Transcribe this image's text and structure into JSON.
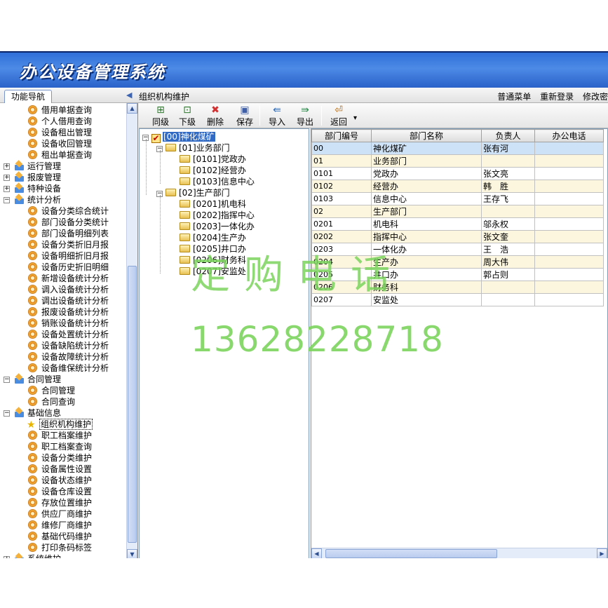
{
  "app": {
    "title": "办公设备管理系统"
  },
  "caption": {
    "nav_tab": "功能导航",
    "panel_title": "组织机构维护",
    "menu_links": [
      "普通菜单",
      "重新登录",
      "修改密"
    ]
  },
  "nav": {
    "items": [
      {
        "label": "借用单据查询",
        "kind": "leaf"
      },
      {
        "label": "个人借用查询",
        "kind": "leaf"
      },
      {
        "label": "设备租出管理",
        "kind": "leaf"
      },
      {
        "label": "设备收回管理",
        "kind": "leaf"
      },
      {
        "label": "租出单据查询",
        "kind": "leaf"
      },
      {
        "label": "运行管理",
        "kind": "group",
        "expanded": false
      },
      {
        "label": "报废管理",
        "kind": "group",
        "expanded": false
      },
      {
        "label": "特种设备",
        "kind": "group",
        "expanded": false
      },
      {
        "label": "统计分析",
        "kind": "group",
        "expanded": true
      },
      {
        "label": "设备分类综合统计",
        "kind": "leaf"
      },
      {
        "label": "部门设备分类统计",
        "kind": "leaf"
      },
      {
        "label": "部门设备明细列表",
        "kind": "leaf"
      },
      {
        "label": "设备分类折旧月报",
        "kind": "leaf"
      },
      {
        "label": "设备明细折旧月报",
        "kind": "leaf"
      },
      {
        "label": "设备历史折旧明细",
        "kind": "leaf"
      },
      {
        "label": "新增设备统计分析",
        "kind": "leaf"
      },
      {
        "label": "调入设备统计分析",
        "kind": "leaf"
      },
      {
        "label": "调出设备统计分析",
        "kind": "leaf"
      },
      {
        "label": "报废设备统计分析",
        "kind": "leaf"
      },
      {
        "label": "销账设备统计分析",
        "kind": "leaf"
      },
      {
        "label": "设备处置统计分析",
        "kind": "leaf"
      },
      {
        "label": "设备缺陷统计分析",
        "kind": "leaf"
      },
      {
        "label": "设备故障统计分析",
        "kind": "leaf"
      },
      {
        "label": "设备维保统计分析",
        "kind": "leaf"
      },
      {
        "label": "合同管理",
        "kind": "group",
        "expanded": true
      },
      {
        "label": "合同管理",
        "kind": "leaf"
      },
      {
        "label": "合同查询",
        "kind": "leaf"
      },
      {
        "label": "基础信息",
        "kind": "group",
        "expanded": true
      },
      {
        "label": "组织机构维护",
        "kind": "leaf",
        "selected": true
      },
      {
        "label": "职工档案维护",
        "kind": "leaf"
      },
      {
        "label": "职工档案查询",
        "kind": "leaf"
      },
      {
        "label": "设备分类维护",
        "kind": "leaf"
      },
      {
        "label": "设备属性设置",
        "kind": "leaf"
      },
      {
        "label": "设备状态维护",
        "kind": "leaf"
      },
      {
        "label": "设备仓库设置",
        "kind": "leaf"
      },
      {
        "label": "存放位置维护",
        "kind": "leaf"
      },
      {
        "label": "供应厂商维护",
        "kind": "leaf"
      },
      {
        "label": "维修厂商维护",
        "kind": "leaf"
      },
      {
        "label": "基础代码维护",
        "kind": "leaf"
      },
      {
        "label": "打印条码标签",
        "kind": "leaf"
      },
      {
        "label": "系统维护",
        "kind": "group",
        "expanded": false
      }
    ]
  },
  "toolbar": {
    "buttons": [
      {
        "label": "同级",
        "icon": "add-sibling-icon"
      },
      {
        "label": "下级",
        "icon": "add-child-icon"
      },
      {
        "label": "删除",
        "icon": "delete-icon"
      },
      {
        "label": "保存",
        "icon": "save-icon"
      },
      {
        "label": "导入",
        "icon": "import-icon"
      },
      {
        "label": "导出",
        "icon": "export-icon"
      },
      {
        "label": "返回",
        "icon": "back-icon"
      }
    ]
  },
  "tree": {
    "root": "[00]神化煤矿",
    "nodes": [
      {
        "label": "[01]业务部门",
        "level": 1
      },
      {
        "label": "[0101]党政办",
        "level": 2
      },
      {
        "label": "[0102]经营办",
        "level": 2
      },
      {
        "label": "[0103]信息中心",
        "level": 2
      },
      {
        "label": "[02]生产部门",
        "level": 1
      },
      {
        "label": "[0201]机电科",
        "level": 2
      },
      {
        "label": "[0202]指挥中心",
        "level": 2
      },
      {
        "label": "[0203]一体化办",
        "level": 2
      },
      {
        "label": "[0204]生产办",
        "level": 2
      },
      {
        "label": "[0205]井口办",
        "level": 2
      },
      {
        "label": "[0206]财务科",
        "level": 2
      },
      {
        "label": "[0207]安监处",
        "level": 2
      }
    ]
  },
  "grid": {
    "columns": [
      "部门编号",
      "部门名称",
      "负责人",
      "办公电话"
    ],
    "rows": [
      [
        "00",
        "神化煤矿",
        "张有河",
        ""
      ],
      [
        "01",
        "业务部门",
        "",
        ""
      ],
      [
        "0101",
        "党政办",
        "张文亮",
        ""
      ],
      [
        "0102",
        "经营办",
        "韩　胜",
        ""
      ],
      [
        "0103",
        "信息中心",
        "王存飞",
        ""
      ],
      [
        "02",
        "生产部门",
        "",
        ""
      ],
      [
        "0201",
        "机电科",
        "邬永权",
        ""
      ],
      [
        "0202",
        "指挥中心",
        "张文奎",
        ""
      ],
      [
        "0203",
        "一体化办",
        "王　浩",
        ""
      ],
      [
        "0204",
        "生产办",
        "周大伟",
        ""
      ],
      [
        "0205",
        "井口办",
        "郭占则",
        ""
      ],
      [
        "0206",
        "财务科",
        "",
        ""
      ],
      [
        "0207",
        "安监处",
        "",
        ""
      ]
    ]
  },
  "watermark": {
    "text": "定购电话",
    "phone": "13628228718"
  }
}
